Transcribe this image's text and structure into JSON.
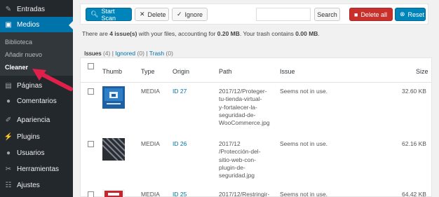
{
  "sidebar": {
    "items": [
      {
        "label": "Entradas",
        "icon": "pin-icon"
      },
      {
        "label": "Medios",
        "icon": "media-icon"
      },
      {
        "label": "Páginas",
        "icon": "pages-icon"
      },
      {
        "label": "Comentarios",
        "icon": "comments-icon"
      },
      {
        "label": "Apariencia",
        "icon": "appearance-icon"
      },
      {
        "label": "Plugins",
        "icon": "plugins-icon"
      },
      {
        "label": "Usuarios",
        "icon": "users-icon"
      },
      {
        "label": "Herramientas",
        "icon": "tools-icon"
      },
      {
        "label": "Ajustes",
        "icon": "settings-icon"
      }
    ],
    "submenu": [
      "Biblioteca",
      "Añadir nuevo",
      "Cleaner"
    ]
  },
  "toolbar": {
    "start_scan": "Start Scan",
    "delete": "Delete",
    "ignore": "Ignore",
    "search_value": "",
    "search": "Search",
    "delete_all": "Delete all",
    "reset": "Reset"
  },
  "summary": {
    "prefix": "There are ",
    "count": "4 issue(s)",
    "middle": " with your files, accounting for ",
    "size": "0.20 MB",
    "trash_text": ". Your trash contains ",
    "trash_size": "0.00 MB",
    "suffix": "."
  },
  "tabs": {
    "issues": "Issues",
    "issues_count": "(4)",
    "ignored": "Ignored",
    "ignored_count": "(0)",
    "trash": "Trash",
    "trash_count": "(0)",
    "sep": "|"
  },
  "table": {
    "columns": [
      "Thumb",
      "Type",
      "Origin",
      "Path",
      "Issue",
      "Size"
    ],
    "rows": [
      {
        "type": "MEDIA",
        "origin": "ID 27",
        "path": [
          "2017/12/Proteger-",
          "tu-tienda-virtual-",
          "y-fortalecer-la-",
          "seguridad-de-",
          "WooCommerce.jpg"
        ],
        "issue": "Seems not in use.",
        "size": "32.60 KB"
      },
      {
        "type": "MEDIA",
        "origin": "ID 26",
        "path": [
          "2017/12",
          "/Protección-del-",
          "sitio-web-con-",
          "plugin-de-",
          "seguridad.jpg"
        ],
        "issue": "Seems not in use.",
        "size": "62.16 KB"
      },
      {
        "type": "MEDIA",
        "origin": "ID 25",
        "path": [
          "2017/12/Restringir-"
        ],
        "issue": "Seems not in use.",
        "size": "64.42 KB"
      }
    ]
  },
  "colors": {
    "accent": "#0073aa",
    "danger": "#c9302c",
    "pointer": "#e0204a",
    "sidebar": "#23282d"
  }
}
